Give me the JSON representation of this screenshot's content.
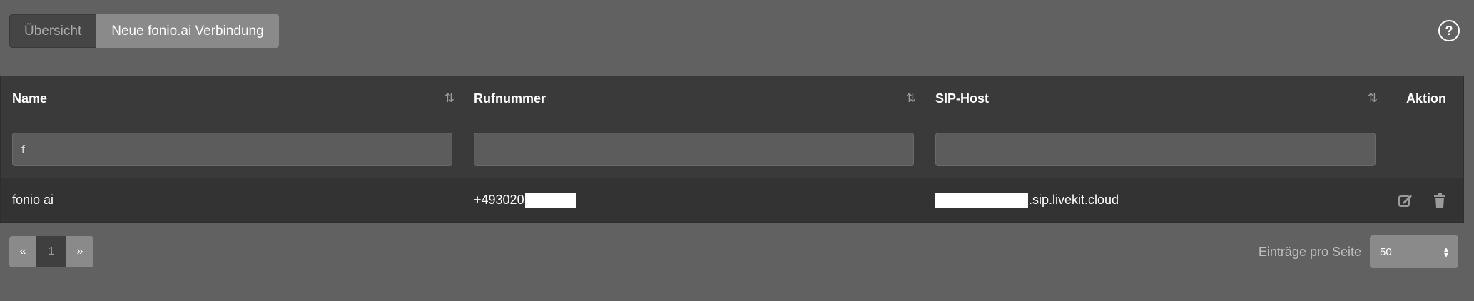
{
  "tabs": [
    {
      "label": "Übersicht",
      "active": false
    },
    {
      "label": "Neue fonio.ai Verbindung",
      "active": true
    }
  ],
  "help": {
    "label": "?"
  },
  "table": {
    "columns": [
      {
        "label": "Name",
        "sortable": true
      },
      {
        "label": "Rufnummer",
        "sortable": true
      },
      {
        "label": "SIP-Host",
        "sortable": true
      },
      {
        "label": "Aktion",
        "sortable": false
      }
    ],
    "filters": {
      "name": "f",
      "nr": "",
      "sip": ""
    },
    "rows": [
      {
        "name": "fonio ai",
        "nr_prefix": "+493020",
        "sip_suffix": ".sip.livekit.cloud"
      }
    ],
    "sort_glyph": "⇅"
  },
  "pagination": {
    "prev": "«",
    "current": "1",
    "next": "»"
  },
  "per_page": {
    "label": "Einträge pro Seite",
    "value": "50"
  },
  "icons": {
    "edit": "edit-icon",
    "delete": "trash-icon",
    "help": "question-icon"
  },
  "colors": {
    "background": "#616161",
    "table": "#3a3a3a",
    "active_tab": "#8a8a8a"
  }
}
